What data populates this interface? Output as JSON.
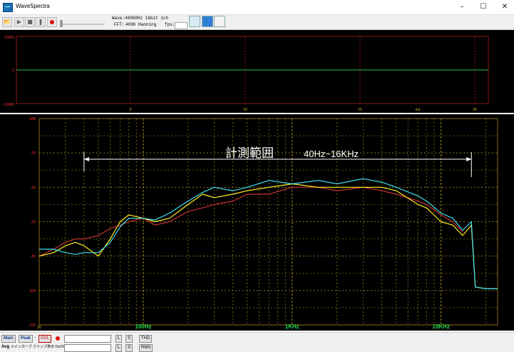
{
  "window": {
    "title": "WaveSpectra",
    "controls": [
      "–",
      "☐",
      "✕"
    ]
  },
  "toolbar": {
    "wave_label": "Wave:",
    "wave_value": "48000Hz 16bit 1ch",
    "fft_label": "FFT:",
    "fft_value": "4096 Hanning",
    "fps_label": "fps:"
  },
  "waveform": {
    "y_ticks": [
      "10000",
      "0",
      "-10000"
    ],
    "x_ticks": [
      "5",
      "10",
      "15",
      "20"
    ],
    "x_unit": "ms"
  },
  "spectrum": {
    "y_ticks": [
      "0dB",
      "-20",
      "-40",
      "-60",
      "-80",
      "-100",
      "-120"
    ],
    "x_ticks_major": [
      "100Hz",
      "1KHz",
      "10KHz"
    ],
    "x_ticks_minor": [
      "20"
    ],
    "annotation_title": "計測範囲",
    "annotation_range": "40Hz~16KHz"
  },
  "chart_data": {
    "type": "line",
    "x_scale": "log",
    "xlabel": "",
    "ylabel": "",
    "xlim": [
      20,
      24000
    ],
    "ylim": [
      -120,
      0
    ],
    "series": [
      {
        "color": "#40e0f0",
        "x": [
          20,
          25,
          30,
          35,
          40,
          50,
          60,
          70,
          80,
          100,
          120,
          150,
          200,
          250,
          300,
          400,
          500,
          700,
          1000,
          1500,
          2000,
          3000,
          4000,
          5000,
          7000,
          8000,
          10000,
          12000,
          14000,
          16000,
          17000,
          20000,
          24000
        ],
        "y": [
          -76,
          -76,
          -78,
          -79,
          -78,
          -78,
          -72,
          -63,
          -58,
          -58,
          -59,
          -55,
          -48,
          -43,
          -40,
          -42,
          -40,
          -36,
          -38,
          -36,
          -38,
          -35,
          -37,
          -40,
          -45,
          -48,
          -55,
          -58,
          -65,
          -60,
          -98,
          -99,
          -99
        ]
      },
      {
        "color": "#ffee22",
        "x": [
          20,
          25,
          30,
          35,
          40,
          50,
          60,
          70,
          80,
          100,
          120,
          150,
          200,
          250,
          300,
          400,
          500,
          700,
          1000,
          1500,
          2000,
          3000,
          4000,
          5000,
          7000,
          8000,
          10000,
          12000,
          14000,
          16000,
          17000,
          20000,
          24000
        ],
        "y": [
          -80,
          -78,
          -74,
          -72,
          -74,
          -80,
          -70,
          -60,
          -56,
          -58,
          -60,
          -58,
          -50,
          -44,
          -46,
          -44,
          -42,
          -40,
          -38,
          -40,
          -40,
          -40,
          -40,
          -42,
          -50,
          -52,
          -60,
          -62,
          -68,
          -62,
          -98,
          -99,
          -99
        ]
      },
      {
        "color": "#c83232",
        "x": [
          20,
          25,
          30,
          35,
          40,
          50,
          60,
          70,
          80,
          100,
          120,
          150,
          200,
          250,
          300,
          400,
          500,
          700,
          1000,
          1500,
          2000,
          3000,
          4000,
          5000,
          7000,
          8000,
          10000,
          12000,
          14000
        ],
        "y": [
          -80,
          -76,
          -72,
          -70,
          -70,
          -68,
          -64,
          -62,
          -60,
          -58,
          -62,
          -60,
          -54,
          -52,
          -50,
          -48,
          -44,
          -44,
          -40,
          -40,
          -42,
          -40,
          -42,
          -44,
          -48,
          -50,
          -56,
          -60,
          -66
        ]
      }
    ]
  },
  "status": {
    "main_label": "Main",
    "peak_label": "Peak",
    "ovl_label": "OVL",
    "l_label": "L",
    "s_label": "S",
    "thd_label": "THD",
    "rms_label": "RMS",
    "avg_label": "Avg",
    "avg_desc": "メインカーブ クリップ表示 On/Off"
  }
}
